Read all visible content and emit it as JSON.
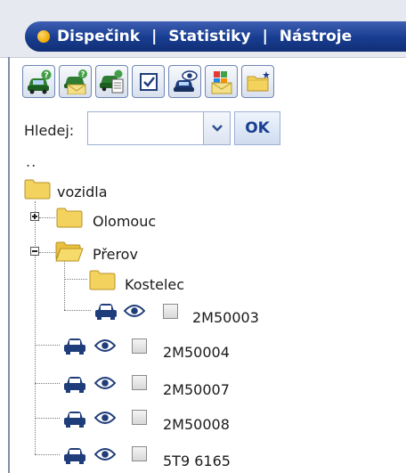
{
  "nav": {
    "items": [
      "Dispečink",
      "Statistiky",
      "Nástroje"
    ],
    "separator": "|"
  },
  "toolbar": {
    "buttons": [
      {
        "icon": "car-question-icon"
      },
      {
        "icon": "car-mail-question-icon"
      },
      {
        "icon": "car-copy-icon"
      },
      {
        "icon": "checkbox-icon"
      },
      {
        "icon": "car-view-icon"
      },
      {
        "icon": "group-mail-icon"
      },
      {
        "icon": "new-folder-icon"
      }
    ]
  },
  "search": {
    "label": "Hledej:",
    "value": "",
    "ok_label": "OK"
  },
  "tree": {
    "parent_link": "..",
    "root": "vozidla",
    "folders": [
      {
        "name": "Olomouc",
        "state": "collapsed"
      },
      {
        "name": "Přerov",
        "state": "expanded"
      },
      {
        "name": "Kostelec",
        "state": "leaf"
      }
    ],
    "vehicles": [
      {
        "plate": "2M50003",
        "checked": false
      },
      {
        "plate": "2M50004",
        "checked": false
      },
      {
        "plate": "2M50007",
        "checked": false
      },
      {
        "plate": "2M50008",
        "checked": false
      },
      {
        "plate": "5T9 6165",
        "checked": false
      }
    ]
  },
  "colors": {
    "nav_background": "#173c8f",
    "nav_text": "#ffffff",
    "folder": "#f3d35d",
    "car_icon": "#1f3d7a",
    "ok_text": "#1b3f92"
  }
}
